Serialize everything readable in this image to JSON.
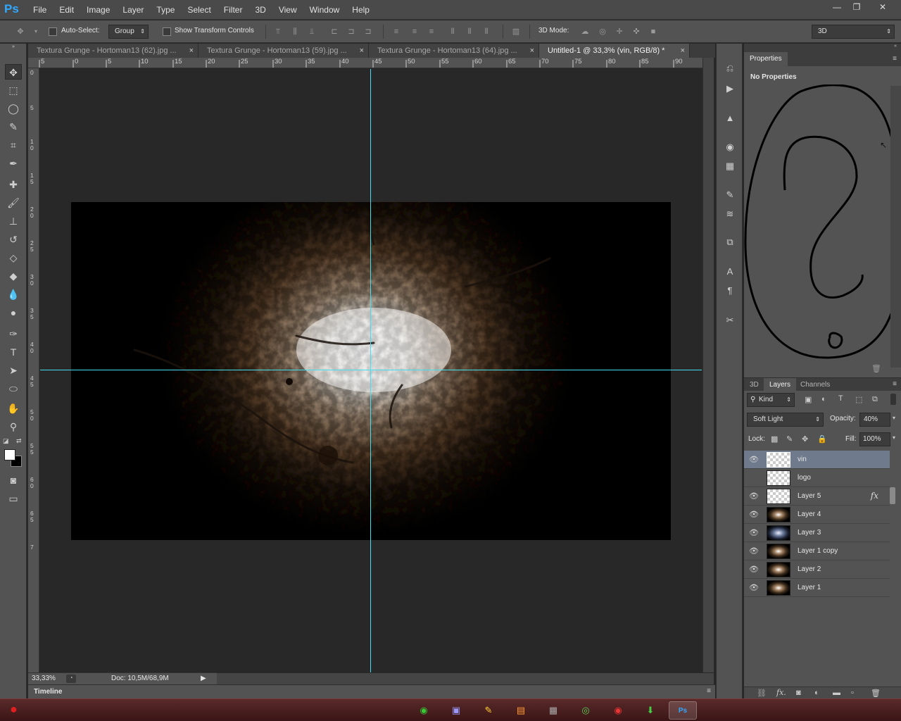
{
  "app": {
    "logo": "Ps"
  },
  "menu": [
    "File",
    "Edit",
    "Image",
    "Layer",
    "Type",
    "Select",
    "Filter",
    "3D",
    "View",
    "Window",
    "Help"
  ],
  "window_controls": {
    "minimize": "—",
    "restore": "❐",
    "close": "✕"
  },
  "options": {
    "auto_select_label": "Auto-Select:",
    "auto_select_value": "Group",
    "show_transform_label": "Show Transform Controls",
    "mode_label": "3D Mode:",
    "workspace_value": "3D"
  },
  "tabs": [
    {
      "label": "Textura Grunge - Hortoman13 (62).jpg ...",
      "close": "×"
    },
    {
      "label": "Textura Grunge - Hortoman13 (59).jpg ...",
      "close": "×"
    },
    {
      "label": "Textura Grunge - Hortoman13 (64).jpg ...",
      "close": "×"
    },
    {
      "label": "Untitled-1 @ 33,3% (vin, RGB/8) *",
      "close": "×"
    }
  ],
  "ruler_top": [
    "5",
    "0",
    "5",
    "10",
    "15",
    "20",
    "25",
    "30",
    "35",
    "40",
    "45",
    "50",
    "55",
    "60",
    "65",
    "70",
    "75",
    "80",
    "85",
    "90"
  ],
  "ruler_left": [
    "0",
    "5",
    "1 0",
    "1 5",
    "2 0",
    "2 5",
    "3 0",
    "3 5",
    "4 0",
    "4 5",
    "5 0",
    "5 5",
    "6 0",
    "6 5",
    "7"
  ],
  "status": {
    "zoom": "33,33%",
    "doc": "Doc: 10,5M/68,9M"
  },
  "timeline_label": "Timeline",
  "properties": {
    "tab": "Properties",
    "message": "No Properties"
  },
  "layers_panel": {
    "tabs": [
      "3D",
      "Layers",
      "Channels"
    ],
    "filter_kind": "Kind",
    "blend_mode": "Soft Light",
    "opacity_label": "Opacity:",
    "opacity_value": "40%",
    "lock_label": "Lock:",
    "fill_label": "Fill:",
    "fill_value": "100%",
    "layers": [
      {
        "name": "vin",
        "thumb": "checker",
        "visible": true,
        "selected": true
      },
      {
        "name": "logo",
        "thumb": "checker",
        "visible": false,
        "selected": false
      },
      {
        "name": "Layer 5",
        "thumb": "checker",
        "visible": true,
        "selected": false,
        "fx": "fx"
      },
      {
        "name": "Layer 4",
        "thumb": "dark",
        "visible": true,
        "selected": false
      },
      {
        "name": "Layer 3",
        "thumb": "blue",
        "visible": true,
        "selected": false
      },
      {
        "name": "Layer 1 copy",
        "thumb": "dark",
        "visible": true,
        "selected": false
      },
      {
        "name": "Layer 2",
        "thumb": "dark",
        "visible": true,
        "selected": false
      },
      {
        "name": "Layer 1",
        "thumb": "dark",
        "visible": true,
        "selected": false
      }
    ]
  },
  "colors": {
    "guide": "#40e0f0",
    "selected_layer": "#6f7a8c",
    "accent": "#31a8ff"
  }
}
